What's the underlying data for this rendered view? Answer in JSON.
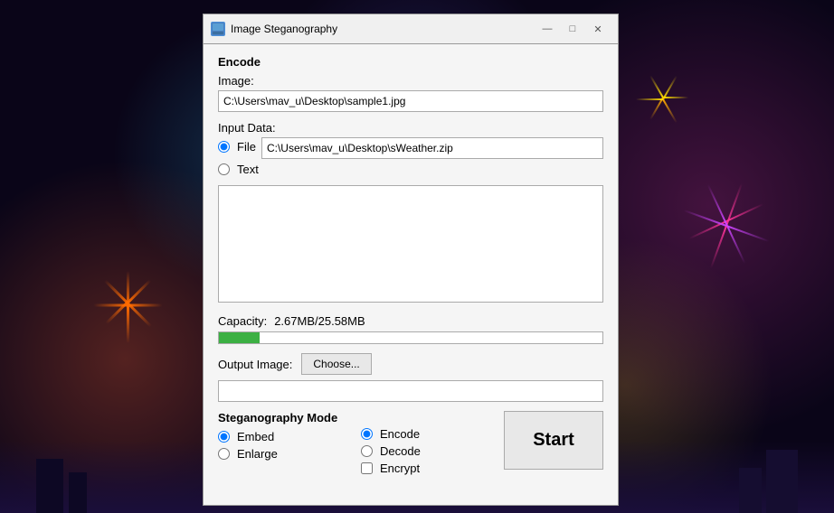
{
  "window": {
    "title": "Image Steganography",
    "icon_label": "IS",
    "minimize_label": "—",
    "maximize_label": "□",
    "close_label": "✕"
  },
  "encode_section": {
    "label": "Encode",
    "image_label": "Image:",
    "image_path": "C:\\Users\\mav_u\\Desktop\\sample1.jpg"
  },
  "input_data": {
    "label": "Input Data:",
    "file_option": "File",
    "text_option": "Text",
    "file_path": "C:\\Users\\mav_u\\Desktop\\sWeather.zip",
    "text_value": ""
  },
  "capacity": {
    "label": "Capacity:",
    "value": "2.67MB/25.58MB",
    "fill_percent": 10.5
  },
  "output_image": {
    "label": "Output Image:",
    "choose_label": "Choose...",
    "path": ""
  },
  "steg_mode": {
    "label": "Steganography Mode",
    "embed_option": "Embed",
    "enlarge_option": "Enlarge"
  },
  "encode_decode": {
    "encode_option": "Encode",
    "decode_option": "Decode",
    "encrypt_option": "Encrypt"
  },
  "start_button": {
    "label": "Start"
  }
}
